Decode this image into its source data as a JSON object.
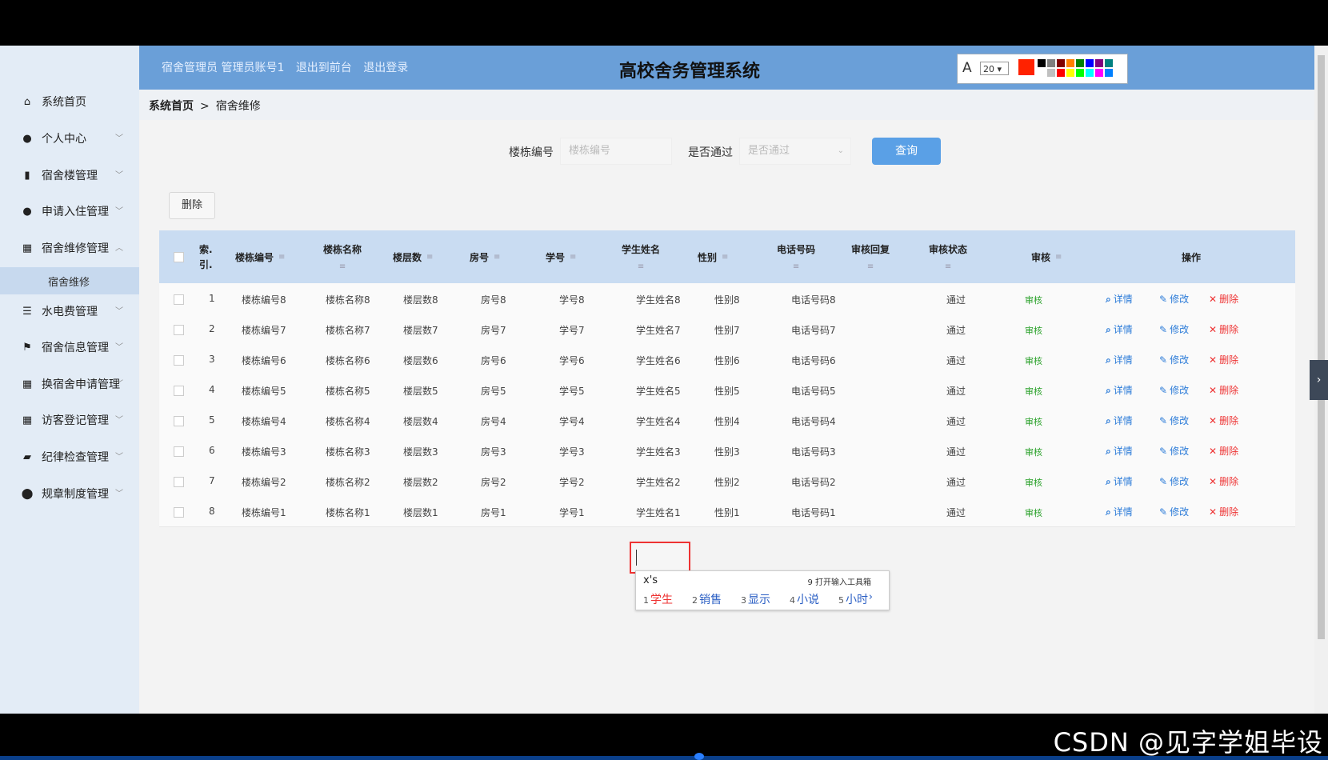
{
  "header": {
    "user_role": "宿舍管理员 管理员账号1",
    "back_front": "退出到前台",
    "logout": "退出登录",
    "title": "高校舍务管理系统",
    "font_tool": {
      "label": "A",
      "size": "20"
    },
    "accent": "#6a9fd8"
  },
  "sidebar": {
    "items": [
      {
        "label": "系统首页",
        "icon": "home-icon"
      },
      {
        "label": "个人中心",
        "icon": "user-icon"
      },
      {
        "label": "宿舍楼管理",
        "icon": "building-icon"
      },
      {
        "label": "申请入住管理",
        "icon": "user-icon"
      },
      {
        "label": "宿舍维修管理",
        "icon": "grid-icon"
      },
      {
        "label": "水电费管理",
        "icon": "list-icon"
      },
      {
        "label": "宿舍信息管理",
        "icon": "flag-icon"
      },
      {
        "label": "换宿舍申请管理",
        "icon": "grid-icon"
      },
      {
        "label": "访客登记管理",
        "icon": "grid-icon"
      },
      {
        "label": "纪律检查管理",
        "icon": "briefcase-icon"
      },
      {
        "label": "规章制度管理",
        "icon": "pin-icon"
      }
    ],
    "sub_item": "宿舍维修"
  },
  "breadcrumb": {
    "home": "系统首页",
    "separator": ">",
    "current": "宿舍维修"
  },
  "search": {
    "building_label": "楼栋编号",
    "building_placeholder": "楼栋编号",
    "pass_label": "是否通过",
    "pass_placeholder": "是否通过",
    "query_button": "查询"
  },
  "toolbar": {
    "delete_button": "删除"
  },
  "table": {
    "headers": [
      "索引",
      "楼栋编号",
      "楼栋名称",
      "楼层数",
      "房号",
      "学号",
      "学生姓名",
      "性别",
      "电话号码",
      "审核回复",
      "审核状态",
      "审核",
      "操作"
    ],
    "index_header_lines": [
      "索.",
      "引."
    ],
    "sort_icon": "≡",
    "rows": [
      {
        "index": "1",
        "building_no": "楼栋编号8",
        "building_name": "楼栋名称8",
        "floors": "楼层数8",
        "room": "房号8",
        "student_no": "学号8",
        "student_name": "学生姓名8",
        "gender": "性别8",
        "phone": "电话号码8",
        "reply": "",
        "status": "通过",
        "audit": "审核"
      },
      {
        "index": "2",
        "building_no": "楼栋编号7",
        "building_name": "楼栋名称7",
        "floors": "楼层数7",
        "room": "房号7",
        "student_no": "学号7",
        "student_name": "学生姓名7",
        "gender": "性别7",
        "phone": "电话号码7",
        "reply": "",
        "status": "通过",
        "audit": "审核"
      },
      {
        "index": "3",
        "building_no": "楼栋编号6",
        "building_name": "楼栋名称6",
        "floors": "楼层数6",
        "room": "房号6",
        "student_no": "学号6",
        "student_name": "学生姓名6",
        "gender": "性别6",
        "phone": "电话号码6",
        "reply": "",
        "status": "通过",
        "audit": "审核"
      },
      {
        "index": "4",
        "building_no": "楼栋编号5",
        "building_name": "楼栋名称5",
        "floors": "楼层数5",
        "room": "房号5",
        "student_no": "学号5",
        "student_name": "学生姓名5",
        "gender": "性别5",
        "phone": "电话号码5",
        "reply": "",
        "status": "通过",
        "audit": "审核"
      },
      {
        "index": "5",
        "building_no": "楼栋编号4",
        "building_name": "楼栋名称4",
        "floors": "楼层数4",
        "room": "房号4",
        "student_no": "学号4",
        "student_name": "学生姓名4",
        "gender": "性别4",
        "phone": "电话号码4",
        "reply": "",
        "status": "通过",
        "audit": "审核"
      },
      {
        "index": "6",
        "building_no": "楼栋编号3",
        "building_name": "楼栋名称3",
        "floors": "楼层数3",
        "room": "房号3",
        "student_no": "学号3",
        "student_name": "学生姓名3",
        "gender": "性别3",
        "phone": "电话号码3",
        "reply": "",
        "status": "通过",
        "audit": "审核"
      },
      {
        "index": "7",
        "building_no": "楼栋编号2",
        "building_name": "楼栋名称2",
        "floors": "楼层数2",
        "room": "房号2",
        "student_no": "学号2",
        "student_name": "学生姓名2",
        "gender": "性别2",
        "phone": "电话号码2",
        "reply": "",
        "status": "通过",
        "audit": "审核"
      },
      {
        "index": "8",
        "building_no": "楼栋编号1",
        "building_name": "楼栋名称1",
        "floors": "楼层数1",
        "room": "房号1",
        "student_no": "学号1",
        "student_name": "学生姓名1",
        "gender": "性别1",
        "phone": "电话号码1",
        "reply": "",
        "status": "通过",
        "audit": "审核"
      }
    ],
    "actions": {
      "detail": "详情",
      "edit": "修改",
      "delete": "删除"
    }
  },
  "ime": {
    "composition": "x's",
    "open_toolbox": "9 打开输入工具箱",
    "candidates": [
      {
        "n": "1",
        "text": "学生"
      },
      {
        "n": "2",
        "text": "销售"
      },
      {
        "n": "3",
        "text": "显示"
      },
      {
        "n": "4",
        "text": "小说"
      },
      {
        "n": "5",
        "text": "小时"
      }
    ],
    "next": "›"
  },
  "watermark": "CSDN @见字学姐毕设",
  "colors": {
    "header": "#6a9fd8",
    "table_header": "#c9dcf2",
    "query_button": "#5aa0e6",
    "delete_red": "#e33333",
    "action_blue": "#2b7bd8",
    "audit_green": "#2aa12a",
    "palette": [
      "#ff0000",
      "#000000",
      "#808080",
      "#800000",
      "#ff8000",
      "#008000",
      "#0000ff",
      "#800080",
      "#008080",
      "#ffffff",
      "#c0c0c0",
      "#ff0000",
      "#ffff00",
      "#00ff00",
      "#00ffff",
      "#ff00ff",
      "#0080ff"
    ]
  }
}
